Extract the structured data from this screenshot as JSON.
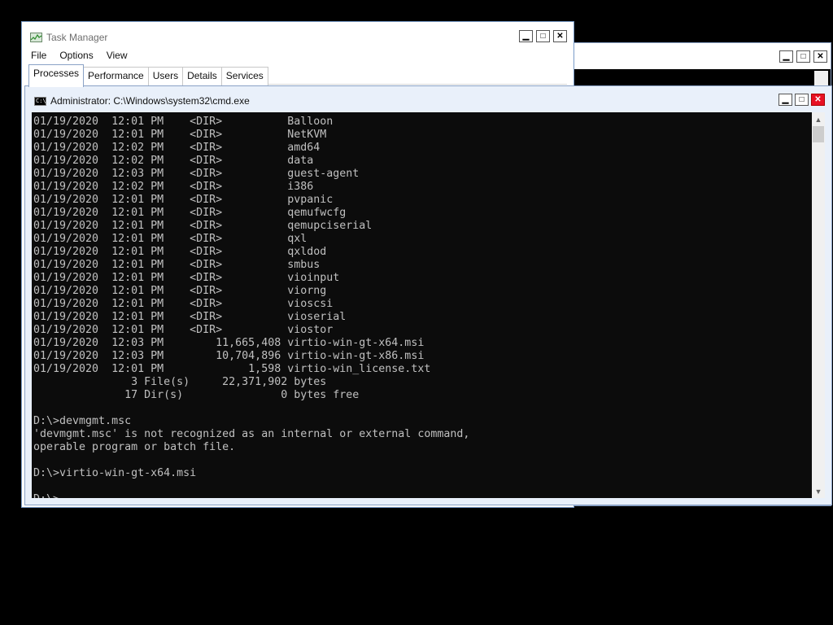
{
  "back_window": {
    "controls": {
      "minimize": "▁",
      "maximize": "□",
      "close": "✕"
    }
  },
  "task_manager": {
    "title": "Task Manager",
    "menu": [
      "File",
      "Options",
      "View"
    ],
    "tabs": [
      "Processes",
      "Performance",
      "Users",
      "Details",
      "Services"
    ],
    "active_tab": "Processes",
    "controls": {
      "minimize": "▁",
      "maximize": "□",
      "close": "✕"
    }
  },
  "cmd": {
    "title": "Administrator: C:\\Windows\\system32\\cmd.exe",
    "icon_text": "C:\\",
    "controls": {
      "minimize": "▁",
      "maximize": "□",
      "close": "✕"
    },
    "lines": [
      "01/19/2020  12:01 PM    <DIR>          Balloon",
      "01/19/2020  12:01 PM    <DIR>          NetKVM",
      "01/19/2020  12:02 PM    <DIR>          amd64",
      "01/19/2020  12:02 PM    <DIR>          data",
      "01/19/2020  12:03 PM    <DIR>          guest-agent",
      "01/19/2020  12:02 PM    <DIR>          i386",
      "01/19/2020  12:01 PM    <DIR>          pvpanic",
      "01/19/2020  12:01 PM    <DIR>          qemufwcfg",
      "01/19/2020  12:01 PM    <DIR>          qemupciserial",
      "01/19/2020  12:01 PM    <DIR>          qxl",
      "01/19/2020  12:01 PM    <DIR>          qxldod",
      "01/19/2020  12:01 PM    <DIR>          smbus",
      "01/19/2020  12:01 PM    <DIR>          vioinput",
      "01/19/2020  12:01 PM    <DIR>          viorng",
      "01/19/2020  12:01 PM    <DIR>          vioscsi",
      "01/19/2020  12:01 PM    <DIR>          vioserial",
      "01/19/2020  12:01 PM    <DIR>          viostor",
      "01/19/2020  12:03 PM        11,665,408 virtio-win-gt-x64.msi",
      "01/19/2020  12:03 PM        10,704,896 virtio-win-gt-x86.msi",
      "01/19/2020  12:01 PM             1,598 virtio-win_license.txt",
      "               3 File(s)     22,371,902 bytes",
      "              17 Dir(s)               0 bytes free",
      "",
      "D:\\>devmgmt.msc",
      "'devmgmt.msc' is not recognized as an internal or external command,",
      "operable program or batch file.",
      "",
      "D:\\>virtio-win-gt-x64.msi",
      ""
    ],
    "prompt": "D:\\>"
  }
}
